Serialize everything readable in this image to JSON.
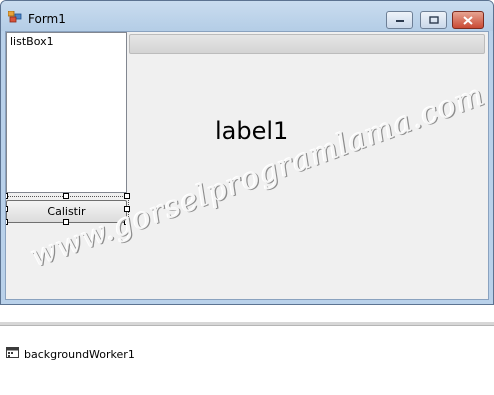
{
  "window": {
    "title": "Form1",
    "minimize_icon": "minimize-icon",
    "maximize_icon": "maximize-icon",
    "close_icon": "close-icon",
    "accent_color": "#b9d1ea",
    "close_color": "#c94a34"
  },
  "form": {
    "listbox_text": "listBox1",
    "progressbar_value": 0,
    "label_text": "label1",
    "button_text": "Calistir",
    "watermark_text": "www.gorselprogramlama.com"
  },
  "tray": {
    "component_label": "backgroundWorker1",
    "component_icon": "background-worker-icon"
  }
}
